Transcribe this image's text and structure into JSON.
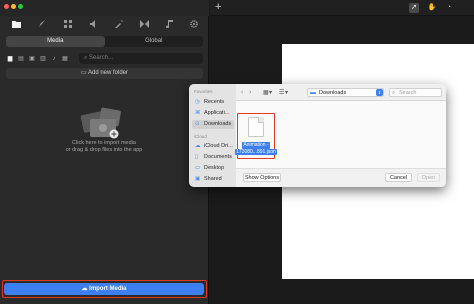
{
  "left_panel": {
    "tabs": {
      "media": "Media",
      "global": "Global"
    },
    "search_placeholder": "Search...",
    "add_folder_label": "Add new folder",
    "empty_state_line1": "Click here to import media",
    "empty_state_line2": "or drag & drop files into the app",
    "import_button_label": "Import Media"
  },
  "file_dialog": {
    "sidebar": {
      "favorites_heading": "Favorites",
      "icloud_heading": "iCloud",
      "items": [
        "Recents",
        "Applicati...",
        "Downloads",
        "iCloud Dri...",
        "Documents",
        "Desktop",
        "Shared"
      ]
    },
    "location": "Downloads",
    "search_placeholder": "Search",
    "file": {
      "name_line1": "Animation -",
      "name_line2": "173080...891.json"
    },
    "buttons": {
      "show_options": "Show Options",
      "cancel": "Cancel",
      "open": "Open"
    }
  },
  "colors": {
    "accent": "#3d7ff0",
    "highlight_border": "#e23a1f"
  },
  "icons": [
    "folder-icon",
    "rocket-icon",
    "grid-icon",
    "audio-icon",
    "magic-icon",
    "transition-icon",
    "music-icon",
    "gear-icon"
  ]
}
